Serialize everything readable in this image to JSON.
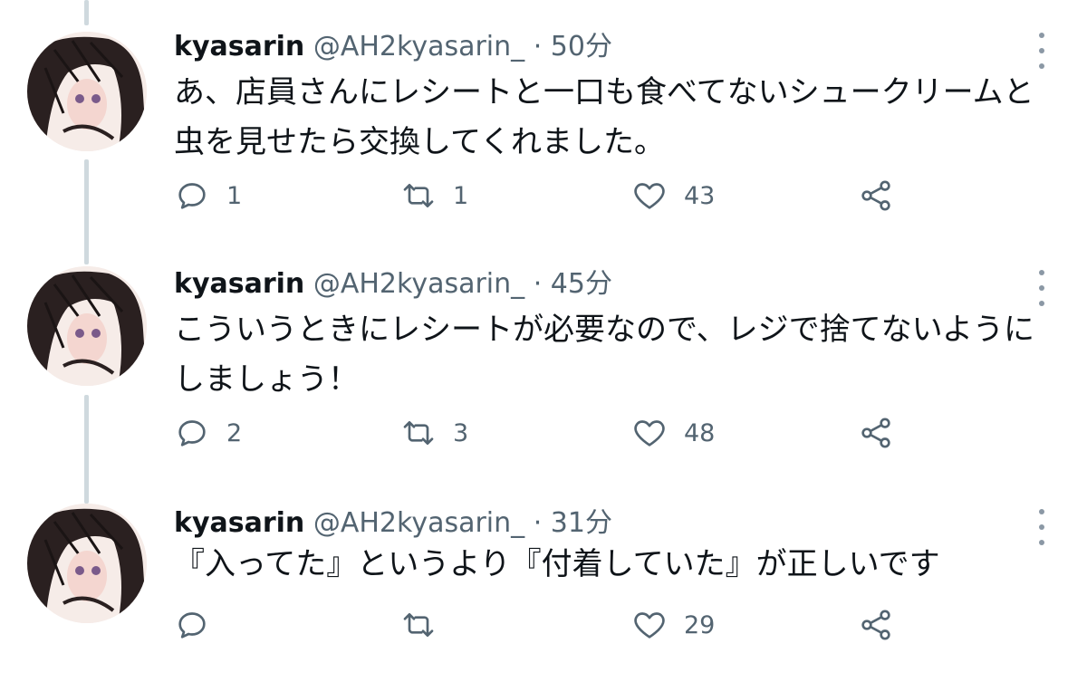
{
  "tweets": [
    {
      "name": "kyasarin",
      "handle": "@AH2kyasarin_",
      "separator": "·",
      "time": "50分",
      "text": "あ、店員さんにレシートと一口も食べてないシュークリームと\n虫を見せたら交換してくれました。",
      "replies": "1",
      "retweets": "1",
      "likes": "43"
    },
    {
      "name": "kyasarin",
      "handle": "@AH2kyasarin_",
      "separator": "·",
      "time": "45分",
      "text": "こういうときにレシートが必要なので、レジで捨てないように\nしましょう！",
      "replies": "2",
      "retweets": "3",
      "likes": "48"
    },
    {
      "name": "kyasarin",
      "handle": "@AH2kyasarin_",
      "separator": "·",
      "time": "31分",
      "text": "『入ってた』というより『付着していた』が正しいです",
      "replies": "",
      "retweets": "",
      "likes": "29"
    }
  ],
  "icons": {
    "reply": "reply-icon",
    "retweet": "retweet-icon",
    "like": "heart-icon",
    "share": "share-icon",
    "more": "more-options-icon"
  },
  "colors": {
    "text": "#0f1419",
    "secondary": "#536471",
    "thread_line": "#cfd9de"
  }
}
